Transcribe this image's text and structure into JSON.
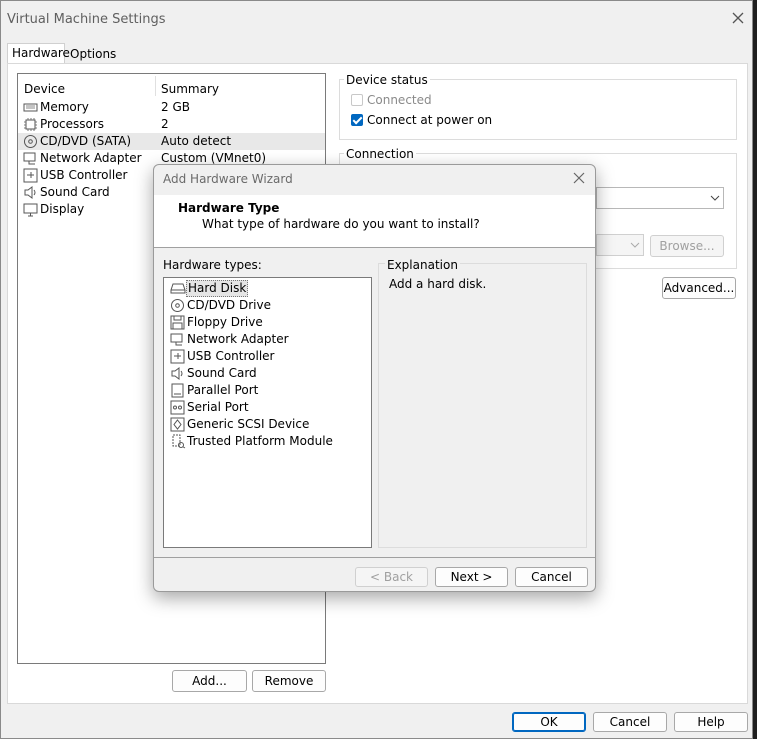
{
  "window": {
    "title": "Virtual Machine Settings"
  },
  "tabs": [
    {
      "label": "Hardware"
    },
    {
      "label": "Options"
    }
  ],
  "device_table": {
    "headers": {
      "device": "Device",
      "summary": "Summary"
    },
    "rows": [
      {
        "device": "Memory",
        "summary": "2 GB",
        "icon": "memory-icon"
      },
      {
        "device": "Processors",
        "summary": "2",
        "icon": "processor-icon"
      },
      {
        "device": "CD/DVD (SATA)",
        "summary": "Auto detect",
        "icon": "cd-dvd-icon"
      },
      {
        "device": "Network Adapter",
        "summary": "Custom (VMnet0)",
        "icon": "network-adapter-icon"
      },
      {
        "device": "USB Controller",
        "summary": "",
        "icon": "usb-controller-icon"
      },
      {
        "device": "Sound Card",
        "summary": "",
        "icon": "sound-card-icon"
      },
      {
        "device": "Display",
        "summary": "",
        "icon": "display-icon"
      }
    ],
    "add_label": "Add...",
    "remove_label": "Remove"
  },
  "device_status": {
    "label": "Device status",
    "connected_label": "Connected",
    "connected_checked": false,
    "connect_power_label": "Connect at power on",
    "connect_power_checked": true
  },
  "connection": {
    "label": "Connection",
    "browse_label": "Browse...",
    "advanced_label": "Advanced..."
  },
  "footer": {
    "ok_label": "OK",
    "cancel_label": "Cancel",
    "help_label": "Help"
  },
  "wizard": {
    "title": "Add Hardware Wizard",
    "heading": "Hardware Type",
    "subheading": "What type of hardware do you want to install?",
    "types_label": "Hardware types:",
    "explanation_label": "Explanation",
    "explanation_text": "Add a hard disk.",
    "selected_index": 0,
    "types": [
      {
        "label": "Hard Disk",
        "icon": "hard-disk-icon"
      },
      {
        "label": "CD/DVD Drive",
        "icon": "cd-dvd-icon"
      },
      {
        "label": "Floppy Drive",
        "icon": "floppy-icon"
      },
      {
        "label": "Network Adapter",
        "icon": "network-adapter-icon"
      },
      {
        "label": "USB Controller",
        "icon": "usb-controller-icon"
      },
      {
        "label": "Sound Card",
        "icon": "sound-card-icon"
      },
      {
        "label": "Parallel Port",
        "icon": "parallel-port-icon"
      },
      {
        "label": "Serial Port",
        "icon": "serial-port-icon"
      },
      {
        "label": "Generic SCSI Device",
        "icon": "scsi-icon"
      },
      {
        "label": "Trusted Platform Module",
        "icon": "tpm-icon"
      }
    ],
    "back_label": "< Back",
    "next_label": "Next >",
    "cancel_label": "Cancel"
  }
}
